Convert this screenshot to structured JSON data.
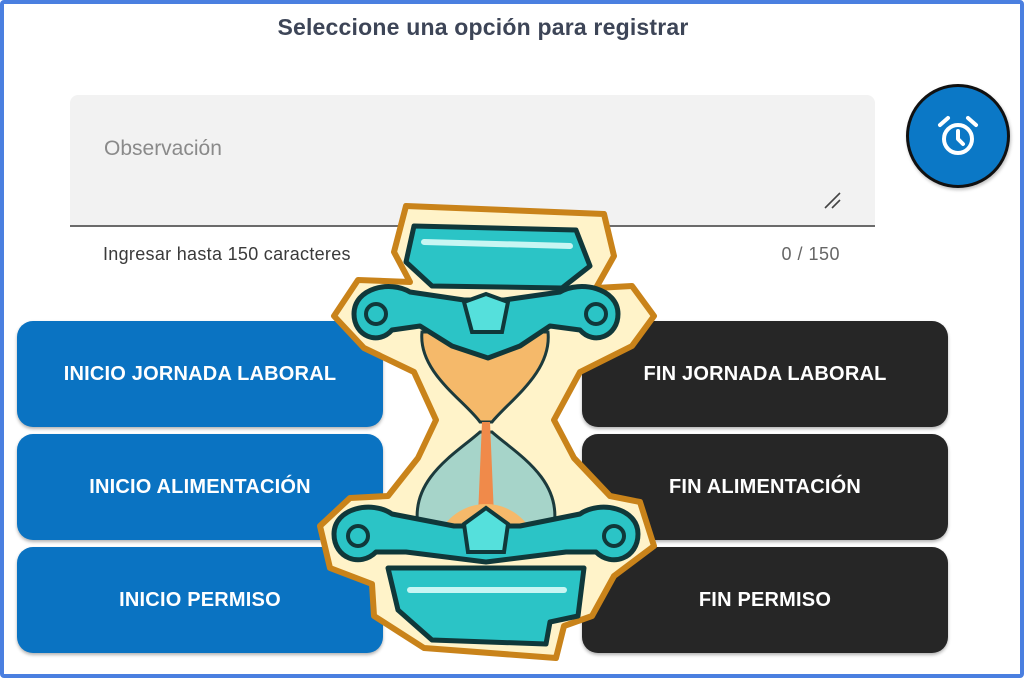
{
  "header": {
    "title": "Seleccione una opción para registrar"
  },
  "observation": {
    "placeholder": "Observación",
    "value": "",
    "hint": "Ingresar hasta 150 caracteres",
    "counter": "0 / 150"
  },
  "fab": {
    "icon": "alarm-clock-icon"
  },
  "buttons": {
    "inicio_jornada": "INICIO JORNADA LABORAL",
    "fin_jornada": "FIN JORNADA LABORAL",
    "inicio_alimentacion": "INICIO ALIMENTACIÓN",
    "fin_alimentacion": "FIN ALIMENTACIÓN",
    "inicio_permiso": "INICIO PERMISO",
    "fin_permiso": "FIN PERMISO"
  },
  "overlay": {
    "icon": "hourglass-icon"
  },
  "colors": {
    "primary": "#0a73c2",
    "dark": "#262626",
    "frame": "#4a7fe0"
  }
}
